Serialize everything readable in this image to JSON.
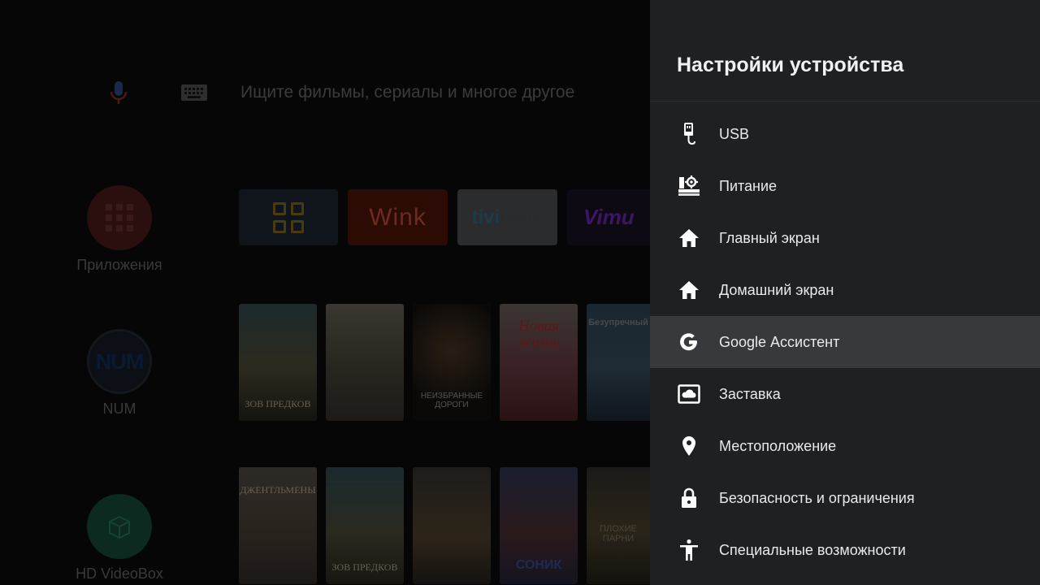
{
  "search": {
    "placeholder": "Ищите фильмы, сериалы и многое другое",
    "mic_icon": "mic-icon",
    "keyboard_icon": "keyboard-icon"
  },
  "side_apps": [
    {
      "label": "Приложения",
      "icon": "apps-grid-icon",
      "color": "#2a0f0e"
    },
    {
      "label": "NUM",
      "badge": "NUM",
      "icon": "num-logo",
      "color": "#0c0f16"
    },
    {
      "label": "HD VideoBox",
      "icon": "hd-videobox-icon",
      "color": "#0c2a20"
    }
  ],
  "app_tiles": [
    {
      "name": "apps-tile",
      "label": "",
      "color": "#0f151b"
    },
    {
      "name": "Wink",
      "label": "Wink",
      "color": "#2c0b05"
    },
    {
      "name": "TiviMate",
      "label_a": "tivi",
      "label_b": "mate",
      "color": "#2b2c2d"
    },
    {
      "name": "Vimu",
      "label": "Vimu",
      "color": "#0d0a14"
    }
  ],
  "posters_row1": [
    {
      "title": "Зов предков"
    },
    {
      "title": ""
    },
    {
      "title": "Неизбранные дороги"
    },
    {
      "top": "Новая жизнь",
      "title": ""
    },
    {
      "top": "Безупречный",
      "title": ""
    }
  ],
  "posters_row2": [
    {
      "title": "Джентльмены"
    },
    {
      "title": "Зов предков"
    },
    {
      "title": ""
    },
    {
      "title": "Соник"
    },
    {
      "title": "Плохие парни"
    }
  ],
  "settings": {
    "title": "Настройки устройства",
    "items": [
      {
        "label": "USB",
        "icon": "usb-icon"
      },
      {
        "label": "Питание",
        "icon": "power-settings-icon"
      },
      {
        "label": "Главный экран",
        "icon": "home-icon"
      },
      {
        "label": "Домашний экран",
        "icon": "home-icon"
      },
      {
        "label": "Google Ассистент",
        "icon": "google-g-icon",
        "focused": true
      },
      {
        "label": "Заставка",
        "icon": "screensaver-icon"
      },
      {
        "label": "Местоположение",
        "icon": "location-pin-icon"
      },
      {
        "label": "Безопасность и ограничения",
        "icon": "lock-icon"
      },
      {
        "label": "Специальные возможности",
        "icon": "accessibility-icon"
      }
    ]
  },
  "colors": {
    "panel_bg": "#1f2022",
    "focused_row": "#38393c",
    "text_primary": "#eaeaea"
  }
}
